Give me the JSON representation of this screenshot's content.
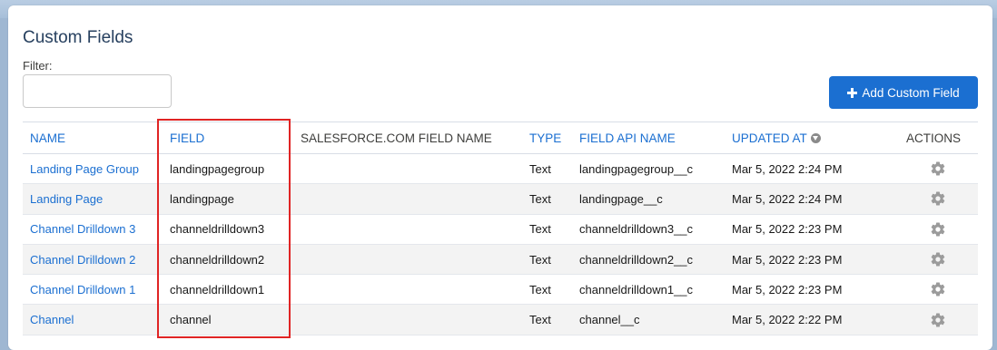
{
  "page": {
    "title": "Custom Fields",
    "filter_label": "Filter:",
    "filter_value": "",
    "add_button_label": "Add Custom Field"
  },
  "table": {
    "headers": {
      "name": "NAME",
      "field": "FIELD",
      "sf_field_name": "SALESFORCE.COM FIELD NAME",
      "type": "TYPE",
      "field_api_name": "FIELD API NAME",
      "updated_at": "UPDATED AT",
      "actions": "ACTIONS"
    },
    "rows": [
      {
        "name": "Landing Page Group",
        "field": "landingpagegroup",
        "sf_field_name": "",
        "type": "Text",
        "field_api_name": "landingpagegroup__c",
        "updated_at": "Mar 5, 2022 2:24 PM"
      },
      {
        "name": "Landing Page",
        "field": "landingpage",
        "sf_field_name": "",
        "type": "Text",
        "field_api_name": "landingpage__c",
        "updated_at": "Mar 5, 2022 2:24 PM"
      },
      {
        "name": "Channel Drilldown 3",
        "field": "channeldrilldown3",
        "sf_field_name": "",
        "type": "Text",
        "field_api_name": "channeldrilldown3__c",
        "updated_at": "Mar 5, 2022 2:23 PM"
      },
      {
        "name": "Channel Drilldown 2",
        "field": "channeldrilldown2",
        "sf_field_name": "",
        "type": "Text",
        "field_api_name": "channeldrilldown2__c",
        "updated_at": "Mar 5, 2022 2:23 PM"
      },
      {
        "name": "Channel Drilldown 1",
        "field": "channeldrilldown1",
        "sf_field_name": "",
        "type": "Text",
        "field_api_name": "channeldrilldown1__c",
        "updated_at": "Mar 5, 2022 2:23 PM"
      },
      {
        "name": "Channel",
        "field": "channel",
        "sf_field_name": "",
        "type": "Text",
        "field_api_name": "channel__c",
        "updated_at": "Mar 5, 2022 2:22 PM"
      }
    ]
  },
  "icons": {
    "add_button": "plus-icon",
    "sort": "sort-descending-icon",
    "row_action": "gear-icon"
  },
  "colors": {
    "accent": "#1b6fd1",
    "highlight": "#e02424",
    "title": "#27405f"
  }
}
